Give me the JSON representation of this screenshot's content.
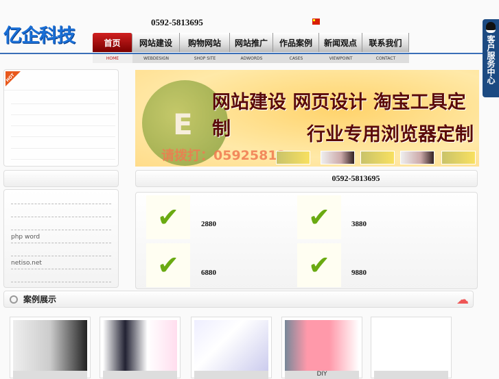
{
  "header": {
    "logo": "亿企科技",
    "phone": "0592-5813695"
  },
  "nav": {
    "tabs": [
      {
        "label": "首页",
        "sub": "HOME"
      },
      {
        "label": "网站建设",
        "sub": "WEBDESIGN"
      },
      {
        "label": "购物网站",
        "sub": "SHOP SITE"
      },
      {
        "label": "网站推广",
        "sub": "ADWORDS"
      },
      {
        "label": "作品案例",
        "sub": "CASES"
      },
      {
        "label": "新闻观点",
        "sub": "VIEWPOINT"
      },
      {
        "label": "联系我们",
        "sub": "CONTACT"
      }
    ]
  },
  "qq": {
    "label": "客户服务中心"
  },
  "hot": {
    "badge": "HOT"
  },
  "left_list": [
    "",
    "",
    "",
    "php   word",
    "",
    "netiso.net",
    ""
  ],
  "banner": {
    "line1": "网站建设 网页设计 淘宝工具定制",
    "line2": "行业专用浏览器定制",
    "call": "请拨打：05925813"
  },
  "phone_bar": "0592-5813695",
  "products": [
    {
      "price": "2880"
    },
    {
      "price": "3880"
    },
    {
      "price": "6880"
    },
    {
      "price": "9880"
    }
  ],
  "cases": {
    "title": "案例展示",
    "items": [
      {
        "caption": ""
      },
      {
        "caption": ""
      },
      {
        "caption": ""
      },
      {
        "caption": "DIY"
      },
      {
        "caption": ""
      }
    ]
  },
  "colors": {
    "accent": "#1a6fd6",
    "nav_active": "#b01010"
  }
}
